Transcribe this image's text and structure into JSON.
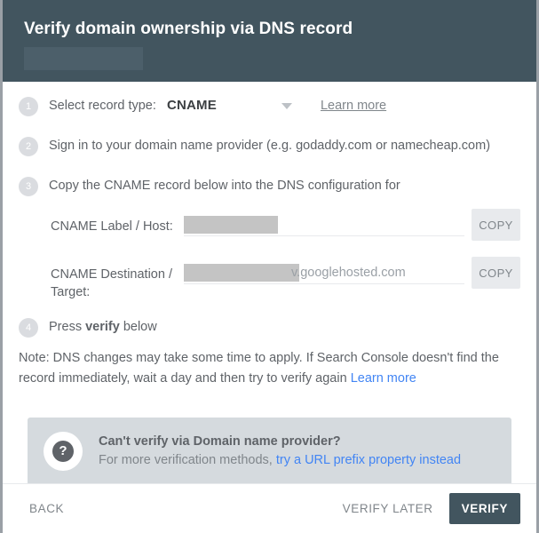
{
  "header": {
    "title": "Verify domain ownership via DNS record",
    "redacted_domain": ""
  },
  "steps": [
    {
      "number": "1",
      "text": "Select record type:",
      "record_type_value": "CNAME",
      "record_type_options": [
        "CNAME"
      ],
      "learn_more_label": "Learn more"
    },
    {
      "number": "2",
      "text": "Sign in to your domain name provider (e.g. godaddy.com or namecheap.com)"
    },
    {
      "number": "3",
      "text": "Copy the CNAME record below into the DNS configuration for"
    },
    {
      "number": "4",
      "text_before": "Press ",
      "text_bold": "verify",
      "text_after": " below"
    }
  ],
  "fields": [
    {
      "label": "CNAME Label / Host:",
      "value": "",
      "suffix": "",
      "copy_label": "COPY"
    },
    {
      "label": "CNAME Destination / Target:",
      "value": "",
      "suffix": "v.googlehosted.com",
      "copy_label": "COPY"
    }
  ],
  "note": {
    "text": "Note: DNS changes may take some time to apply. If Search Console doesn't find the record immediately, wait a day and then try to verify again ",
    "link_label": "Learn more"
  },
  "callout": {
    "icon": "question-mark-icon",
    "title": "Can't verify via Domain name provider?",
    "subtitle_prefix": "For more verification methods, ",
    "link_label": "try a URL prefix property instead"
  },
  "footer": {
    "back_label": "BACK",
    "verify_later_label": "VERIFY LATER",
    "verify_label": "VERIFY"
  },
  "colors": {
    "header_background": "#42555f",
    "primary_button": "#42555f",
    "link_blue": "#4285f4",
    "callout_background": "#d5dade",
    "redaction_gray": "#c4c4c4"
  }
}
